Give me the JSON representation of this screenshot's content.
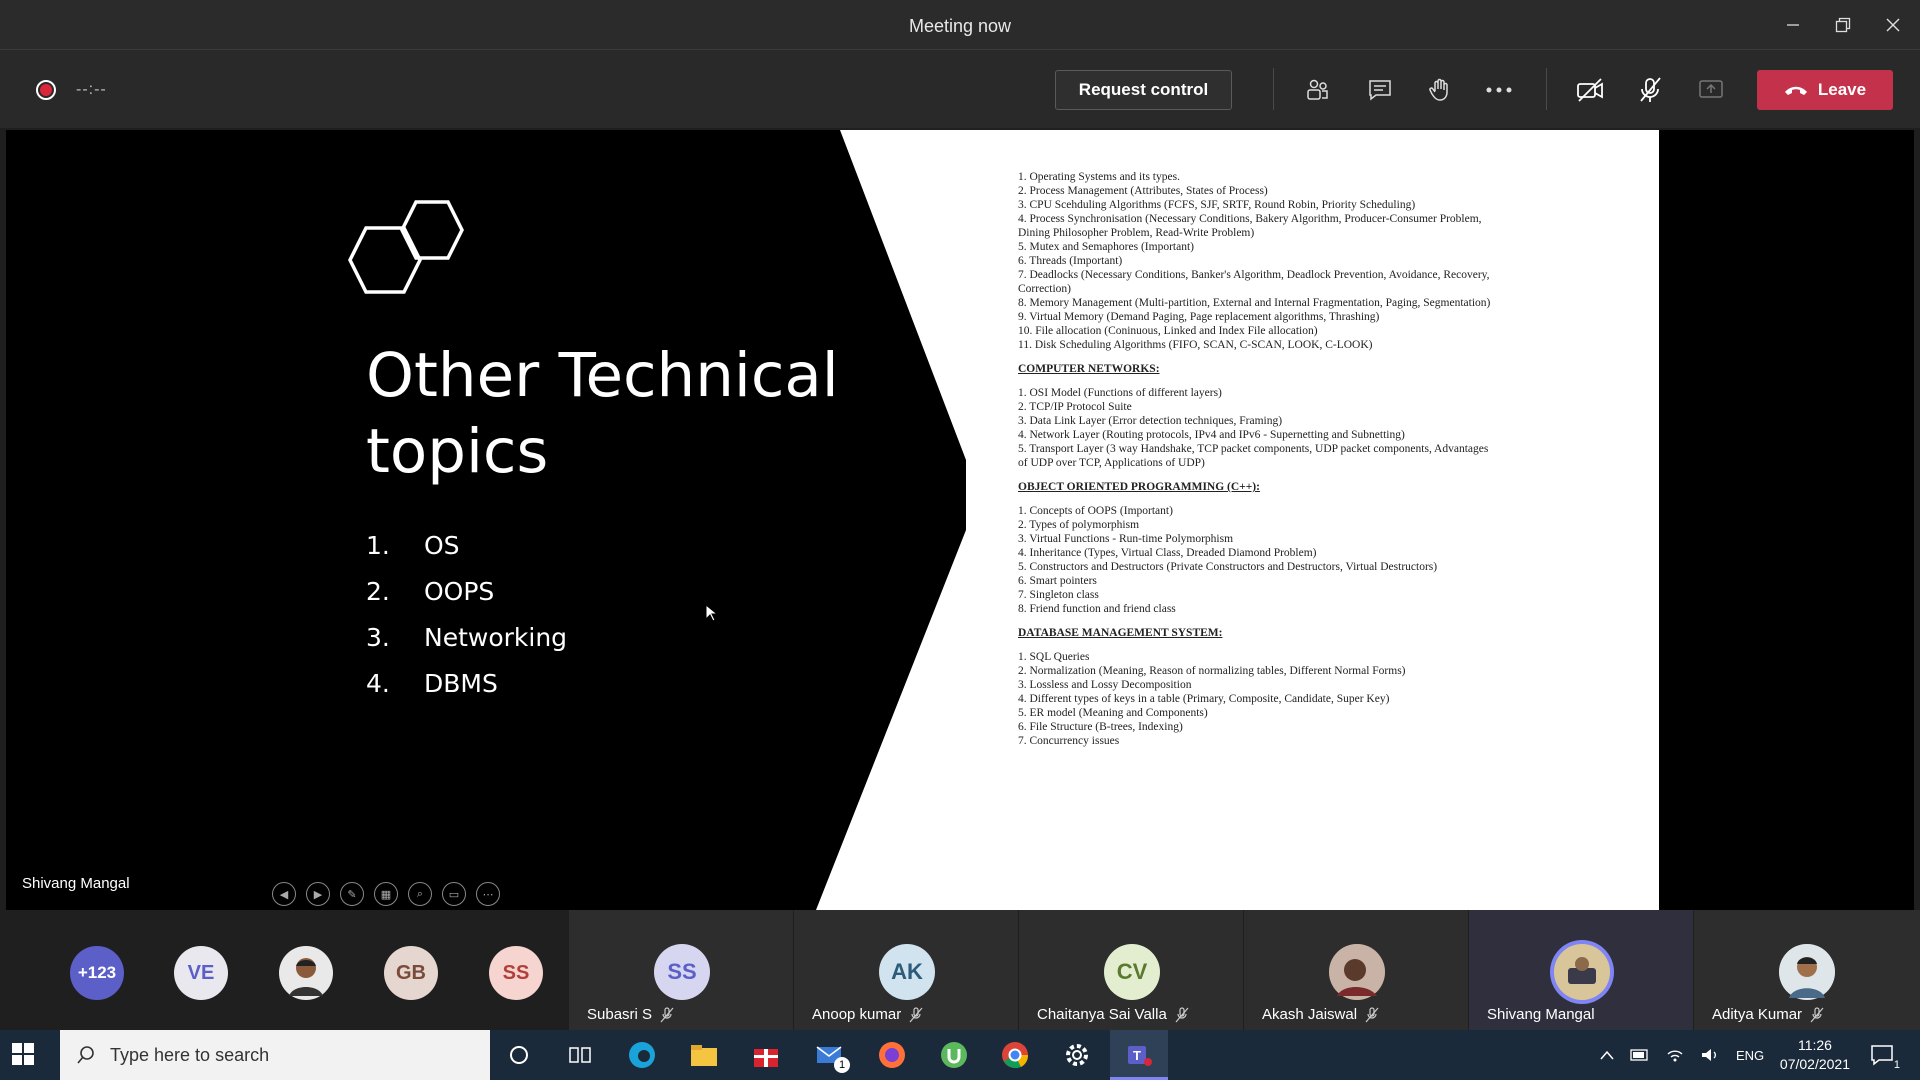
{
  "window": {
    "title": "Meeting now"
  },
  "toolbar": {
    "timer": "--:--",
    "request_control": "Request control",
    "leave": "Leave",
    "icons": [
      "participants-icon",
      "chat-icon",
      "raise-hand-icon",
      "more-options-icon",
      "camera-off-icon",
      "mic-off-icon",
      "share-tray-icon"
    ]
  },
  "slide": {
    "title": "Other Technical topics",
    "items": [
      {
        "num": "1.",
        "text": "OS"
      },
      {
        "num": "2.",
        "text": "OOPS"
      },
      {
        "num": "3.",
        "text": "Networking"
      },
      {
        "num": "4.",
        "text": "DBMS"
      }
    ]
  },
  "doc": {
    "os": [
      "1. Operating Systems and its types.",
      "2. Process Management (Attributes, States of Process)",
      "3. CPU Scehduling Algorithms (FCFS, SJF, SRTF, Round Robin, Priority Scheduling)",
      "4. Process Synchronisation (Necessary Conditions, Bakery Algorithm, Producer-Consumer Problem,",
      "Dining Philosopher Problem, Read-Write Problem)",
      "5. Mutex and Semaphores (Important)",
      "6. Threads (Important)",
      "7. Deadlocks (Necessary Conditions, Banker's Algorithm, Deadlock Prevention, Avoidance, Recovery,",
      "Correction)",
      "8. Memory Management (Multi-partition, External and Internal Fragmentation, Paging, Segmentation)",
      "9. Virtual Memory (Demand Paging, Page replacement algorithms, Thrashing)",
      "10. File allocation (Coninuous, Linked and Index File allocation)",
      "11. Disk Scheduling Algorithms (FIFO, SCAN, C-SCAN, LOOK, C-LOOK)"
    ],
    "cn_head": "COMPUTER NETWORKS:",
    "cn": [
      "1. OSI Model (Functions of different layers)",
      "2. TCP/IP Protocol Suite",
      "3. Data Link Layer (Error detection techniques, Framing)",
      "4. Network Layer (Routing protocols, IPv4 and IPv6 - Supernetting and Subnetting)",
      "5. Transport Layer (3 way Handshake, TCP packet components, UDP packet components, Advantages",
      "of UDP over TCP, Applications of UDP)"
    ],
    "oop_head": "OBJECT ORIENTED PROGRAMMING (C++):",
    "oop": [
      "1. Concepts of OOPS (Important)",
      "2. Types of polymorphism",
      "3. Virtual Functions - Run-time Polymorphism",
      "4. Inheritance (Types, Virtual Class, Dreaded Diamond Problem)",
      "5. Constructors and Destructors (Private Constructors and Destructors, Virtual Destructors)",
      "6. Smart pointers",
      "7. Singleton class",
      "8. Friend function and friend class"
    ],
    "db_head": "DATABASE MANAGEMENT SYSTEM:",
    "db": [
      "1. SQL Queries",
      "2. Normalization (Meaning, Reason of normalizing tables, Different Normal Forms)",
      "3. Lossless and Lossy Decomposition",
      "4. Different types of keys in a table (Primary, Composite, Candidate, Super Key)",
      "5. ER model (Meaning and Components)",
      "6. File Structure (B-trees, Indexing)",
      "7. Concurrency issues"
    ]
  },
  "presenter_label": "Shivang Mangal",
  "participants": {
    "overflow": "+123",
    "mini": [
      {
        "initials": "VE",
        "bg": "#e8e8ee",
        "fg": "#5b5fc7"
      },
      {
        "initials": "",
        "bg": "#2a2a2a",
        "fg": "#fff"
      },
      {
        "initials": "GB",
        "bg": "#e6d6d0",
        "fg": "#7a4a3a"
      },
      {
        "initials": "SS",
        "bg": "#f6d4d0",
        "fg": "#b0403a"
      }
    ],
    "tiles": [
      {
        "initials": "SS",
        "name": "Subasri S",
        "bg": "#d6d6f0",
        "fg": "#5b5fc7",
        "muted": true
      },
      {
        "initials": "AK",
        "name": "Anoop kumar",
        "bg": "#d0e3ee",
        "fg": "#2d5b7a",
        "muted": true
      },
      {
        "initials": "CV",
        "name": "Chaitanya Sai Valla",
        "bg": "#e3eed0",
        "fg": "#5b7a2d",
        "muted": true
      },
      {
        "initials": "",
        "name": "Akash Jaiswal",
        "bg": "#8a6a5a",
        "fg": "#fff",
        "muted": true
      },
      {
        "initials": "",
        "name": "Shivang Mangal",
        "bg": "#c9a86a",
        "fg": "#fff",
        "muted": false
      },
      {
        "initials": "",
        "name": "Aditya Kumar",
        "bg": "#6a8aa0",
        "fg": "#fff",
        "muted": true
      }
    ]
  },
  "taskbar": {
    "search_placeholder": "Type here to search",
    "lang": "ENG",
    "time": "11:26",
    "date": "07/02/2021",
    "mail_badge": "1",
    "notif_badge": "1"
  },
  "colors": {
    "leave": "#c4314b",
    "accent": "#5b5fc7",
    "record": "#d9263a"
  }
}
